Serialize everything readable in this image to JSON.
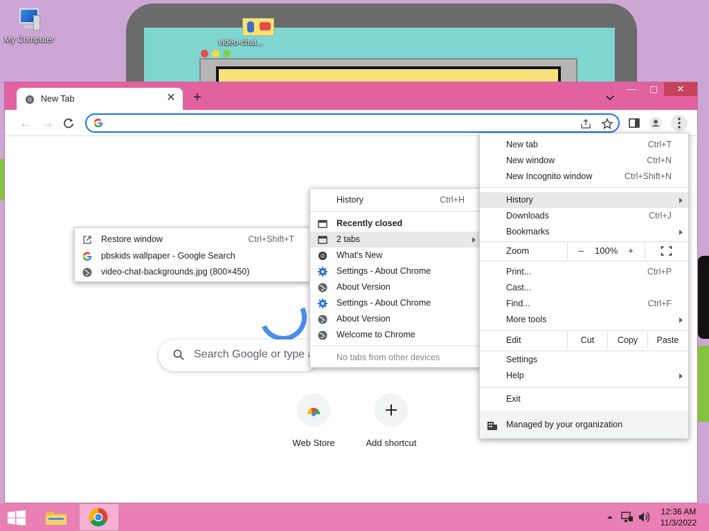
{
  "desktop": {
    "icons": [
      {
        "label": "My Computer"
      },
      {
        "label": "video-chat..."
      }
    ]
  },
  "browser": {
    "tab": {
      "title": "New Tab"
    },
    "page": {
      "search_placeholder": "Search Google or type a",
      "shortcuts": [
        {
          "label": "Web Store"
        },
        {
          "label": "Add shortcut"
        }
      ]
    }
  },
  "main_menu": {
    "items": [
      {
        "label": "New tab",
        "shortcut": "Ctrl+T"
      },
      {
        "label": "New window",
        "shortcut": "Ctrl+N"
      },
      {
        "label": "New Incognito window",
        "shortcut": "Ctrl+Shift+N"
      },
      {
        "label": "History"
      },
      {
        "label": "Downloads",
        "shortcut": "Ctrl+J"
      },
      {
        "label": "Bookmarks"
      },
      {
        "label": "Print...",
        "shortcut": "Ctrl+P"
      },
      {
        "label": "Cast..."
      },
      {
        "label": "Find...",
        "shortcut": "Ctrl+F"
      },
      {
        "label": "More tools"
      },
      {
        "label": "Settings"
      },
      {
        "label": "Help"
      },
      {
        "label": "Exit"
      }
    ],
    "zoom": {
      "label": "Zoom",
      "minus": "–",
      "value": "100%",
      "plus": "+"
    },
    "edit": {
      "label": "Edit",
      "cut": "Cut",
      "copy": "Copy",
      "paste": "Paste"
    },
    "managed": "Managed by your organization"
  },
  "history_menu": {
    "history": {
      "label": "History",
      "shortcut": "Ctrl+H"
    },
    "recently_closed": "Recently closed",
    "items": [
      {
        "label": "2 tabs"
      },
      {
        "label": "What's New"
      },
      {
        "label": "Settings - About Chrome"
      },
      {
        "label": "About Version"
      },
      {
        "label": "Settings - About Chrome"
      },
      {
        "label": "About Version"
      },
      {
        "label": "Welcome to Chrome"
      }
    ],
    "footer": "No tabs from other devices"
  },
  "tabs_submenu": {
    "restore": {
      "label": "Restore window",
      "shortcut": "Ctrl+Shift+T"
    },
    "items": [
      {
        "label": "pbskids wallpaper - Google Search"
      },
      {
        "label": "video-chat-backgrounds.jpg (800×450)"
      }
    ]
  },
  "taskbar": {
    "clock": {
      "time": "12:36 AM",
      "date": "11/3/2022"
    }
  }
}
